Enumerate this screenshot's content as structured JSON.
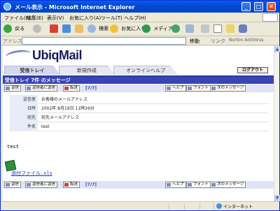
{
  "window": {
    "title": "メール表示 - Microsoft Internet Explorer",
    "minimize": "_",
    "maximize": "□",
    "close": "✕"
  },
  "menu": [
    "ファイル(F)",
    "編集(E)",
    "表示(V)",
    "お気に入り(A)",
    "ツール(T)",
    "ヘルプ(H)"
  ],
  "toolbar": {
    "back": "戻る",
    "search": "検索",
    "favorites": "お気に入り",
    "media": "メディア"
  },
  "address": {
    "label": "アドレス(D)",
    "value": "",
    "go": "移動",
    "links": "リンク",
    "norton": "Norton AntiVirus"
  },
  "app": {
    "logo": "UbiqMail",
    "tabs": [
      "受信トレイ",
      "新規作成",
      "オンラインヘルプ"
    ],
    "logout": "ログアウト",
    "mail_title": "受信トレイ 7件 のメッセージ"
  },
  "actions": {
    "reply": "返信",
    "reply_all": "返信者に返信",
    "forward": "転送",
    "pager": "[7/7]",
    "help": "ヘルプ",
    "font": "フォント",
    "next": "次のメッセージ"
  },
  "headers": [
    {
      "label": "送信者",
      "value": "お客様のメールアドレス"
    },
    {
      "label": "日時",
      "value": "2002年 8月19日 11時26分"
    },
    {
      "label": "宛先",
      "value": "宛先メールアドレス"
    },
    {
      "label": "件名",
      "value": "test"
    }
  ],
  "body": {
    "text": "test",
    "attachment": "添付ファイル.xls"
  },
  "status": {
    "zone": "インターネット"
  },
  "colors": {
    "titlebar": "#0148d6",
    "accent": "#3a45b5",
    "link": "#1a35c8"
  }
}
